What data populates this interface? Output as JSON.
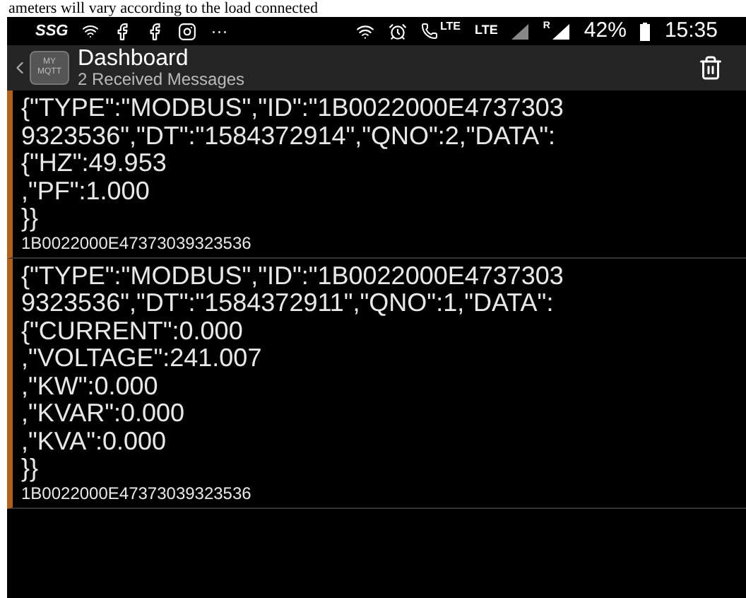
{
  "document_caption": "ameters will vary according to the load connected",
  "status_bar": {
    "carrier": "SSG",
    "more": "···",
    "lte_call": "LTE",
    "lte": "LTE",
    "roaming": "R",
    "battery": "42%",
    "time": "15:35"
  },
  "app_bar": {
    "logo": "MY MQTT",
    "title": "Dashboard",
    "subtitle": "2 Received Messages"
  },
  "messages": [
    {
      "payload_lines": [
        "{\"TYPE\":\"MODBUS\",\"ID\":\"1B0022000E4737303",
        "9323536\",\"DT\":\"1584372914\",\"QNO\":2,\"DATA\":",
        "{\"HZ\":49.953",
        ",\"PF\":1.000",
        "}}"
      ],
      "topic": "1B0022000E47373039323536"
    },
    {
      "payload_lines": [
        "{\"TYPE\":\"MODBUS\",\"ID\":\"1B0022000E4737303",
        "9323536\",\"DT\":\"1584372911\",\"QNO\":1,\"DATA\":",
        "{\"CURRENT\":0.000",
        ",\"VOLTAGE\":241.007",
        ",\"KW\":0.000",
        ",\"KVAR\":0.000",
        ",\"KVA\":0.000",
        "}}"
      ],
      "topic": "1B0022000E47373039323536"
    }
  ]
}
